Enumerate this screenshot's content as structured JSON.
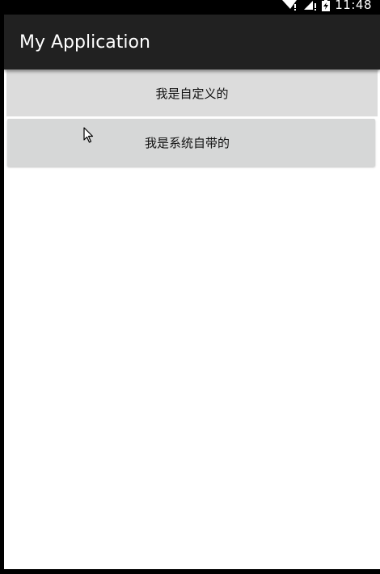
{
  "status_bar": {
    "time": "11:48",
    "icons": [
      "wifi-icon",
      "signal-icon",
      "battery-charging-icon"
    ]
  },
  "app_bar": {
    "title": "My Application"
  },
  "buttons": {
    "custom_label": "我是自定义的",
    "system_label": "我是系统自带的"
  },
  "colors": {
    "status_bar": "#000000",
    "app_bar": "#212121",
    "background": "#ffffff",
    "custom_button": "#dcdcdc",
    "system_button": "#d6d7d7"
  }
}
